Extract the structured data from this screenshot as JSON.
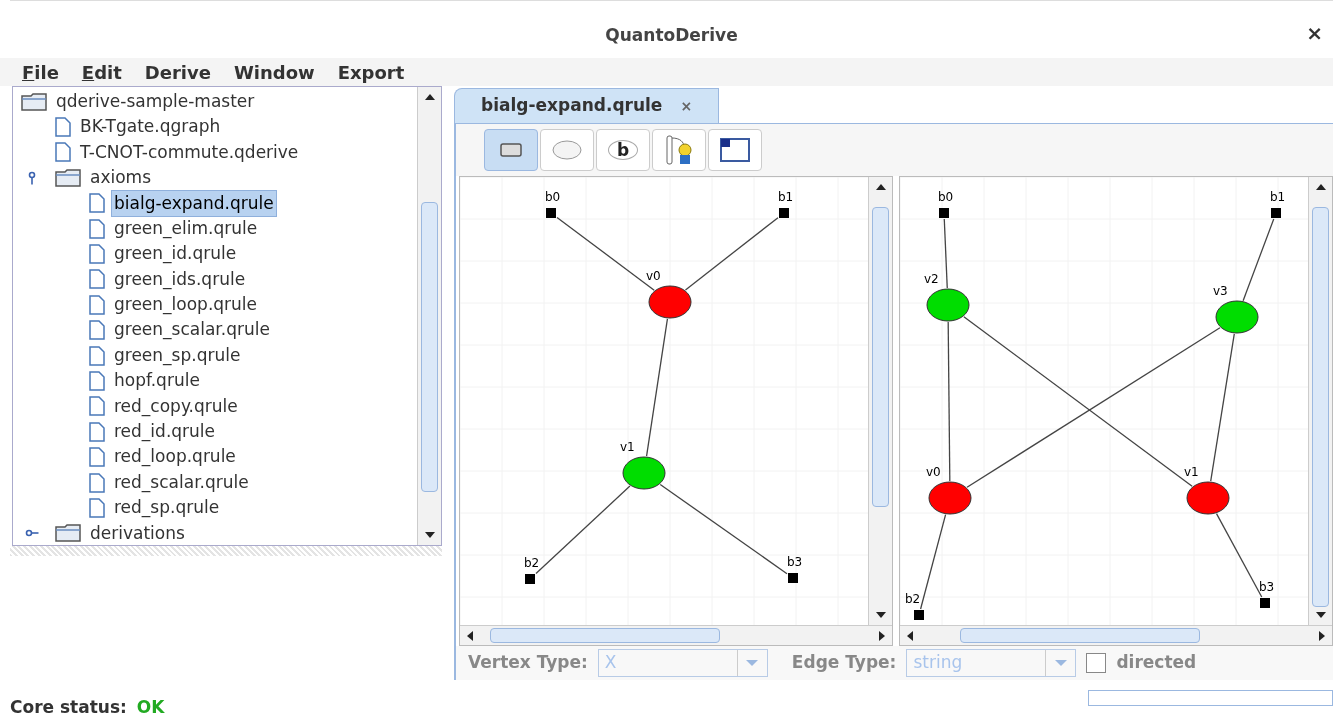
{
  "window": {
    "title": "QuantoDerive",
    "close": "×"
  },
  "menu": [
    {
      "label": "File",
      "mnemonic": true
    },
    {
      "label": "Edit",
      "mnemonic": true
    },
    {
      "label": "Derive",
      "mnemonic": false
    },
    {
      "label": "Window",
      "mnemonic": false
    },
    {
      "label": "Export",
      "mnemonic": false
    }
  ],
  "tree": {
    "label": "qderive-sample-master",
    "kind": "folder",
    "selected": false,
    "children": [
      {
        "label": "BK-Tgate.qgraph",
        "kind": "file",
        "selected": false
      },
      {
        "label": "T-CNOT-commute.qderive",
        "kind": "file",
        "selected": false
      },
      {
        "label": "axioms",
        "kind": "folder",
        "expanded": true,
        "selected": false,
        "children": [
          {
            "label": "bialg-expand.qrule",
            "kind": "file",
            "selected": true
          },
          {
            "label": "green_elim.qrule",
            "kind": "file",
            "selected": false
          },
          {
            "label": "green_id.qrule",
            "kind": "file",
            "selected": false
          },
          {
            "label": "green_ids.qrule",
            "kind": "file",
            "selected": false
          },
          {
            "label": "green_loop.qrule",
            "kind": "file",
            "selected": false
          },
          {
            "label": "green_scalar.qrule",
            "kind": "file",
            "selected": false
          },
          {
            "label": "green_sp.qrule",
            "kind": "file",
            "selected": false
          },
          {
            "label": "hopf.qrule",
            "kind": "file",
            "selected": false
          },
          {
            "label": "red_copy.qrule",
            "kind": "file",
            "selected": false
          },
          {
            "label": "red_id.qrule",
            "kind": "file",
            "selected": false
          },
          {
            "label": "red_loop.qrule",
            "kind": "file",
            "selected": false
          },
          {
            "label": "red_scalar.qrule",
            "kind": "file",
            "selected": false
          },
          {
            "label": "red_sp.qrule",
            "kind": "file",
            "selected": false
          }
        ]
      },
      {
        "label": "derivations",
        "kind": "folder",
        "expanded": false,
        "selected": false
      }
    ]
  },
  "tabs": [
    {
      "label": "bialg-expand.qrule",
      "close": "×",
      "selected": true
    }
  ],
  "toolbar": [
    {
      "kind": "select",
      "selected": true
    },
    {
      "kind": "vertex",
      "selected": false
    },
    {
      "kind": "boundary",
      "glyph": "b",
      "selected": false
    },
    {
      "kind": "edge",
      "selected": false
    },
    {
      "kind": "bangbox",
      "selected": false
    }
  ],
  "graphs": [
    {
      "nodes": [
        {
          "name": "b0",
          "kind": "boundary"
        },
        {
          "name": "b1",
          "kind": "boundary"
        },
        {
          "name": "v0",
          "kind": "red"
        },
        {
          "name": "v1",
          "kind": "green"
        },
        {
          "name": "b2",
          "kind": "boundary"
        },
        {
          "name": "b3",
          "kind": "boundary"
        }
      ]
    },
    {
      "nodes": [
        {
          "name": "b0",
          "kind": "boundary"
        },
        {
          "name": "b1",
          "kind": "boundary"
        },
        {
          "name": "v2",
          "kind": "green"
        },
        {
          "name": "v3",
          "kind": "green"
        },
        {
          "name": "v0",
          "kind": "red"
        },
        {
          "name": "v1",
          "kind": "red"
        },
        {
          "name": "b2",
          "kind": "boundary"
        },
        {
          "name": "b3",
          "kind": "boundary"
        }
      ]
    }
  ],
  "vertex_type": {
    "label": "Vertex Type:",
    "value": "X",
    "disabled": true
  },
  "edge_type": {
    "label": "Edge Type:",
    "value": "string",
    "disabled": true
  },
  "directed": {
    "label": "directed",
    "checked": false
  },
  "status": {
    "label": "Core status:",
    "value": "OK"
  }
}
